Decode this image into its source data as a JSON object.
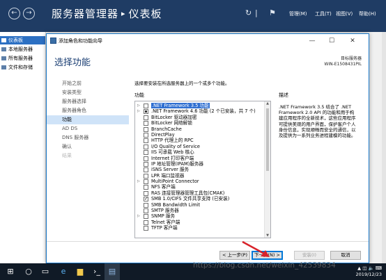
{
  "server_manager": {
    "title": "服务器管理器",
    "separator": "▸",
    "page": "仪表板",
    "menu": [
      "管理(M)",
      "工具(T)",
      "视图(V)",
      "帮助(H)"
    ],
    "sidebar": [
      "仪表板",
      "本地服务器",
      "所有服务器",
      "文件和存储"
    ]
  },
  "dialog": {
    "title": "添加角色和功能向导",
    "heading": "选择功能",
    "target_label": "目标服务器",
    "target_server": "WIN-E1508431PIL",
    "instruction": "选择要安装在所选服务器上的一个或多个功能。",
    "features_header": "功能",
    "description_header": "描述",
    "steps": [
      {
        "label": "开始之前",
        "state": "normal"
      },
      {
        "label": "安装类型",
        "state": "normal"
      },
      {
        "label": "服务器选择",
        "state": "normal"
      },
      {
        "label": "服务器角色",
        "state": "normal"
      },
      {
        "label": "功能",
        "state": "active"
      },
      {
        "label": "AD DS",
        "state": "normal"
      },
      {
        "label": "DNS 服务器",
        "state": "normal"
      },
      {
        "label": "确认",
        "state": "normal"
      },
      {
        "label": "结果",
        "state": "disabled"
      }
    ],
    "features": [
      {
        "label": ".NET Framework 3.5 功能",
        "state": "unchecked",
        "expandable": true,
        "selected": true
      },
      {
        "label": ".NET Framework 4.6 功能 (2 个已安装，共 7 个)",
        "state": "partial",
        "expandable": true,
        "selected": false
      },
      {
        "label": "BitLocker 驱动器加密",
        "state": "unchecked",
        "expandable": false,
        "selected": false
      },
      {
        "label": "BitLocker 网络解锁",
        "state": "unchecked",
        "expandable": false,
        "selected": false
      },
      {
        "label": "BranchCache",
        "state": "unchecked",
        "expandable": false,
        "selected": false
      },
      {
        "label": "DirectPlay",
        "state": "unchecked",
        "expandable": false,
        "selected": false
      },
      {
        "label": "HTTP 代理上的 RPC",
        "state": "unchecked",
        "expandable": false,
        "selected": false
      },
      {
        "label": "I/O Quality of Service",
        "state": "unchecked",
        "expandable": false,
        "selected": false
      },
      {
        "label": "IIS 可承载 Web 核心",
        "state": "unchecked",
        "expandable": false,
        "selected": false
      },
      {
        "label": "Internet 打印客户端",
        "state": "unchecked",
        "expandable": false,
        "selected": false
      },
      {
        "label": "IP 地址管理(IPAM)服务器",
        "state": "unchecked",
        "expandable": false,
        "selected": false
      },
      {
        "label": "iSNS Server 服务",
        "state": "unchecked",
        "expandable": false,
        "selected": false
      },
      {
        "label": "LPR 端口监视器",
        "state": "unchecked",
        "expandable": false,
        "selected": false
      },
      {
        "label": "MultiPoint Connector",
        "state": "unchecked",
        "expandable": true,
        "selected": false
      },
      {
        "label": "NFS 客户端",
        "state": "unchecked",
        "expandable": false,
        "selected": false
      },
      {
        "label": "RAS 连接管理器管理工具包(CMAK)",
        "state": "unchecked",
        "expandable": false,
        "selected": false
      },
      {
        "label": "SMB 1.0/CIFS 文件共享支持 (已安装)",
        "state": "checked",
        "expandable": false,
        "selected": false
      },
      {
        "label": "SMB Bandwidth Limit",
        "state": "unchecked",
        "expandable": false,
        "selected": false
      },
      {
        "label": "SMTP 服务器",
        "state": "unchecked",
        "expandable": false,
        "selected": false
      },
      {
        "label": "SNMP 服务",
        "state": "unchecked",
        "expandable": true,
        "selected": false
      },
      {
        "label": "Telnet 客户端",
        "state": "unchecked",
        "expandable": false,
        "selected": false
      },
      {
        "label": "TFTP 客户端",
        "state": "unchecked",
        "expandable": false,
        "selected": false
      }
    ],
    "description": ".NET Framework 3.5 结合了 .NET Framework 2.0 API 的功能和用于构建应用程序的全新技术，这些应用程序可提供美观的用户界面，保护客户个人身份信息，实现顺畅而安全的通信，以及提供为一系列业务进程建模的功能。",
    "buttons": {
      "previous": "< 上一步(P)",
      "next": "下一步(N) >",
      "install": "安装(I)",
      "cancel": "取消"
    }
  },
  "taskbar": {
    "time": "2019/12/23"
  },
  "watermark": "https://blog.csdn.net/weixin_42539834",
  "colors": {
    "header": "#1f3c64",
    "accent": "#2c70c3",
    "selection": "#2f6fd1",
    "taskbar": "#101a26"
  }
}
